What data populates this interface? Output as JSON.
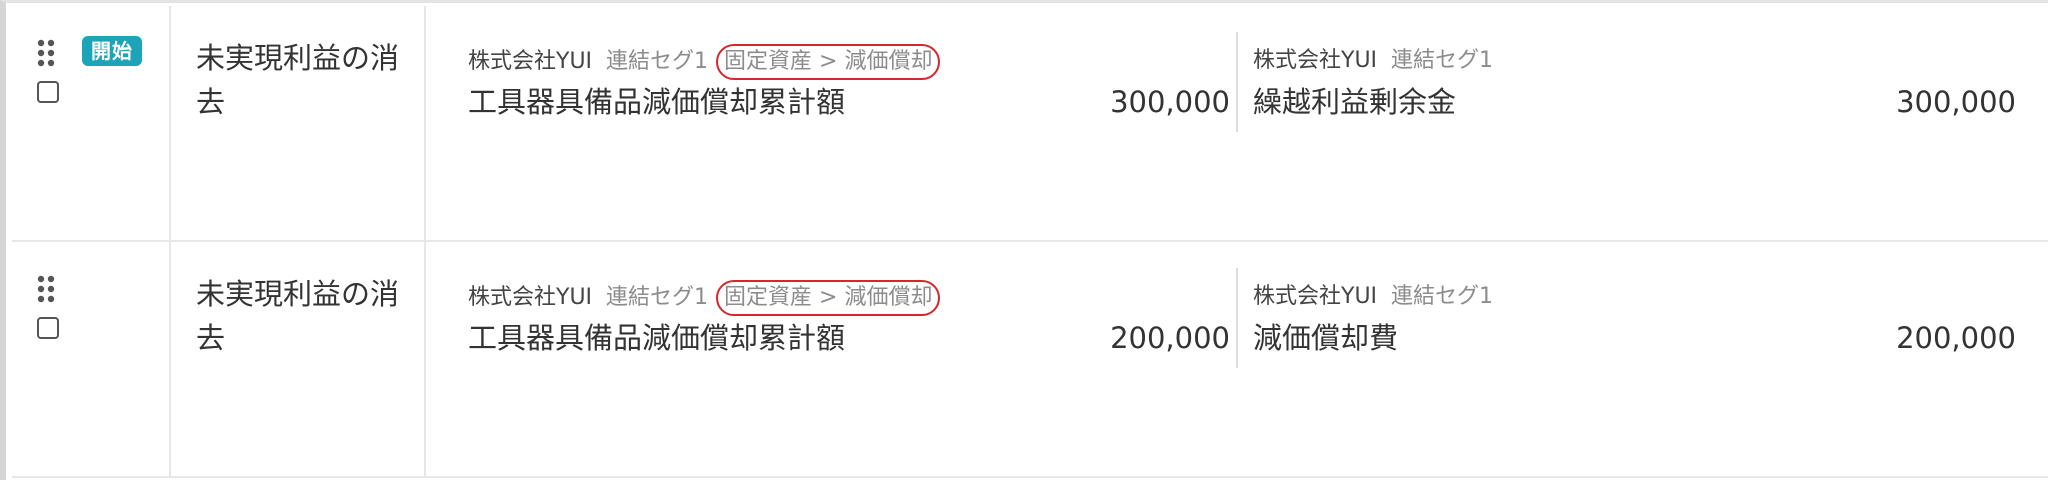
{
  "rows": [
    {
      "badge": "開始",
      "description": "未実現利益の消去",
      "debit": {
        "company": "株式会社YUI",
        "segment": "連結セグ1",
        "tag": "固定資産 > 減価償却",
        "account": "工具器具備品減価償却累計額",
        "amount": "300,000"
      },
      "credit": {
        "company": "株式会社YUI",
        "segment": "連結セグ1",
        "account": "繰越利益剰余金",
        "amount": "300,000"
      }
    },
    {
      "description": "未実現利益の消去",
      "debit": {
        "company": "株式会社YUI",
        "segment": "連結セグ1",
        "tag": "固定資産 > 減価償却",
        "account": "工具器具備品減価償却累計額",
        "amount": "200,000"
      },
      "credit": {
        "company": "株式会社YUI",
        "segment": "連結セグ1",
        "account": "減価償却費",
        "amount": "200,000"
      }
    }
  ],
  "colors": {
    "badge": "#1ea4b8",
    "highlight_border": "#d9262a",
    "secondary_text": "#8c8c8c"
  },
  "icons": {
    "handle": "drag-handle-icon",
    "checkbox": "checkbox-icon"
  }
}
